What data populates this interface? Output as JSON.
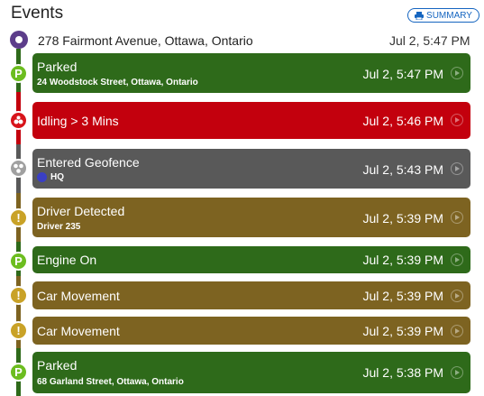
{
  "header": {
    "title": "Events",
    "summary_label": "SUMMARY"
  },
  "start": {
    "address": "278 Fairmont Avenue, Ottawa, Ontario",
    "time": "Jul 2, 5:47 PM"
  },
  "events": [
    {
      "label": "Parked",
      "sub": "24 Woodstock Street, Ottawa, Ontario",
      "time": "Jul 2, 5:47 PM",
      "kind": "parked",
      "color": "#2e6a1a"
    },
    {
      "label": "Idling > 3 Mins",
      "sub": "",
      "time": "Jul 2, 5:46 PM",
      "kind": "idling",
      "color": "#c3000d"
    },
    {
      "label": "Entered Geofence",
      "sub": "HQ",
      "time": "Jul 2, 5:43 PM",
      "kind": "geofence",
      "color": "#595959"
    },
    {
      "label": "Driver Detected",
      "sub": "Driver 235",
      "time": "Jul 2, 5:39 PM",
      "kind": "warning",
      "color": "#7d6321"
    },
    {
      "label": "Engine On",
      "sub": "",
      "time": "Jul 2, 5:39 PM",
      "kind": "parked",
      "color": "#2e6a1a"
    },
    {
      "label": "Car Movement",
      "sub": "",
      "time": "Jul 2, 5:39 PM",
      "kind": "warning",
      "color": "#7d6321"
    },
    {
      "label": "Car Movement",
      "sub": "",
      "time": "Jul 2, 5:39 PM",
      "kind": "warning",
      "color": "#7d6321"
    },
    {
      "label": "Parked",
      "sub": "68 Garland Street, Ottawa, Ontario",
      "time": "Jul 2, 5:38 PM",
      "kind": "parked",
      "color": "#2e6a1a"
    }
  ],
  "icons": {
    "parked": "P",
    "warning": "!",
    "idling": "idle-icon",
    "geofence": "geofence-icon",
    "summary": "printer-icon",
    "play": "play-icon"
  }
}
